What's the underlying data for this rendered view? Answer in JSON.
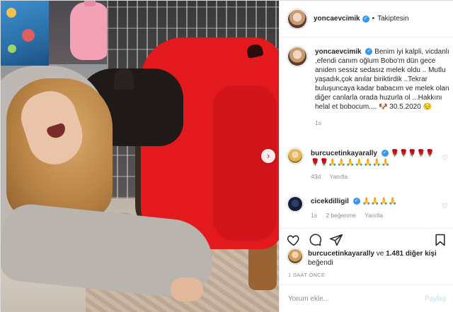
{
  "post": {
    "author": "yoncaevcimik",
    "follow_status": "Takiptesin",
    "separator": "•"
  },
  "caption": {
    "username": "yoncaevcimik",
    "text": "Benim iyi kalpli, vicdanlı ,efendi canım oğlum Bobo'm dün gece aniden sessiz sedasız melek oldu .. Mutlu yaşadık,çok anılar biriktirdik ..Tekrar buluşuncaya kadar babacım ve melek olan diğer canlarla orada huzurla ol ...Hakkını helal et bobocum.... 🐶 30.5.2020 😔",
    "age": "1s"
  },
  "comments": [
    {
      "username": "burcucetinkayarally",
      "text": "🌹🌹🌹🌹🌹🌹🌹🙏🙏🙏🙏🙏🙏🙏",
      "age": "43d",
      "reply_label": "Yanıtla",
      "likes_label": ""
    },
    {
      "username": "cicekdilligil",
      "text": "🙏🙏🙏🙏",
      "age": "1s",
      "likes_label": "2 beğenme",
      "reply_label": "Yanıtla"
    }
  ],
  "likes": {
    "first_liker": "burcucetinkayarally",
    "rest": "ve 1.481 diğer kişi beğendi",
    "connector": "ve",
    "count_text": "1.481 diğer kişi",
    "suffix": "beğendi"
  },
  "timestamp": "1 SAAT ÖNCE",
  "add_comment": {
    "placeholder": "Yorum ekle...",
    "post_label": "Paylaş"
  },
  "icons": {
    "next": "chevron-right-icon",
    "like": "heart-icon",
    "comment": "comment-icon",
    "share": "share-icon",
    "save": "bookmark-icon"
  },
  "colors": {
    "verified": "#3897f0",
    "muted": "#8e8e8e",
    "post_button": "#b2dffc",
    "hoodie": "#e3191e"
  }
}
